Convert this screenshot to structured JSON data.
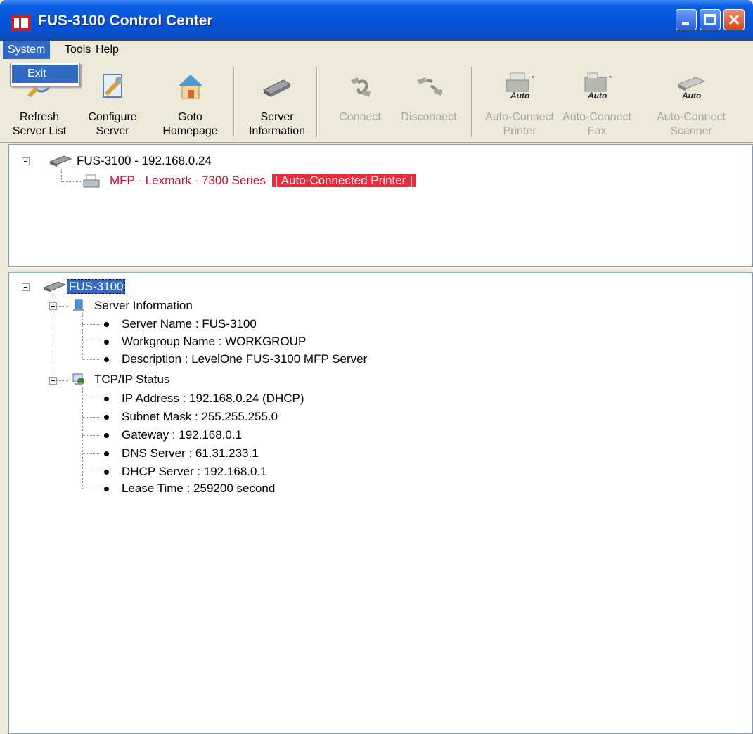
{
  "window": {
    "title": "FUS-3100 Control Center",
    "accent": "#0553d8"
  },
  "menu": {
    "items": [
      {
        "label": "System"
      },
      {
        "label": "Tools"
      },
      {
        "label": "Help"
      }
    ],
    "active": "System",
    "dropdown": {
      "exit_label": "Exit"
    }
  },
  "toolbar": {
    "refresh": {
      "line1": "Refresh",
      "line2": "Server List",
      "icon": "refresh-icon"
    },
    "configure": {
      "line1": "Configure",
      "line2": "Server",
      "icon": "wrench-icon"
    },
    "homepage": {
      "line1": "Goto",
      "line2": "Homepage",
      "icon": "home-icon"
    },
    "server_info": {
      "line1": "Server",
      "line2": "Information",
      "icon": "server-icon"
    },
    "connect": {
      "line1": "Connect",
      "icon": "connect-icon",
      "disabled": true
    },
    "disconnect": {
      "line1": "Disconnect",
      "icon": "disconnect-icon",
      "disabled": true
    },
    "auto_printer": {
      "badge": "Auto",
      "line1": "Auto-Connect",
      "line2": "Printer",
      "icon": "printer-icon",
      "disabled": true
    },
    "auto_fax": {
      "badge": "Auto",
      "line1": "Auto-Connect",
      "line2": "Fax",
      "icon": "fax-icon",
      "disabled": true
    },
    "auto_scanner": {
      "badge": "Auto",
      "line1": "Auto-Connect",
      "line2": "Scanner",
      "icon": "scanner-icon",
      "disabled": true
    }
  },
  "server_list": {
    "server_label": "FUS-3100 - 192.168.0.24",
    "device_label": "MFP - Lexmark -  7300 Series",
    "device_status": "[ Auto-Connected Printer ]",
    "status_color": "#ed2a3a"
  },
  "details": {
    "root": "FUS-3100",
    "server_info_group": "Server Information",
    "server_info_items": [
      "Server Name : FUS-3100",
      "Workgroup Name : WORKGROUP",
      "Description : LevelOne FUS-3100 MFP Server"
    ],
    "tcpip_group": "TCP/IP Status",
    "tcpip_items": [
      "IP Address : 192.168.0.24 (DHCP)",
      "Subnet Mask : 255.255.255.0",
      "Gateway : 192.168.0.1",
      "DNS Server : 61.31.233.1",
      "DHCP Server : 192.168.0.1",
      "Lease Time : 259200 second"
    ]
  }
}
